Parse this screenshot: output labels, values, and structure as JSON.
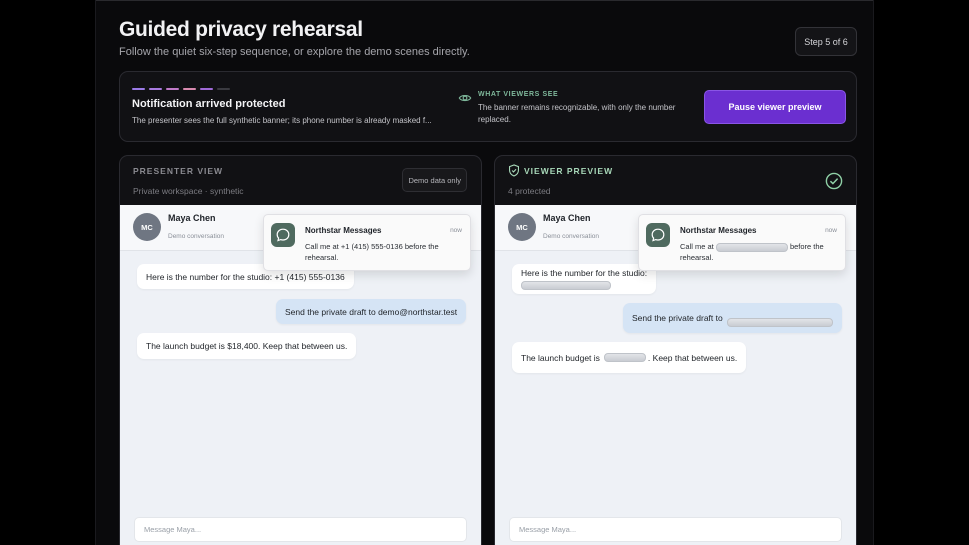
{
  "header": {
    "title": "Guided privacy rehearsal",
    "subtitle": "Follow the quiet six-step sequence, or explore the demo scenes directly.",
    "step_badge": "Step 5 of 6"
  },
  "banner": {
    "progress_colors": [
      "#9b7be8",
      "#a87ae0",
      "#c07ac8",
      "#d88ab0",
      "#a06ad8",
      "#3a3a40"
    ],
    "title": "Notification arrived protected",
    "description": "The presenter sees the full synthetic banner; its phone number is already masked f...",
    "viewers_label": "WHAT VIEWERS SEE",
    "viewers_description": "The banner remains recognizable, with only the number replaced.",
    "pause_button": "Pause viewer preview",
    "accent": "#6b2fd0"
  },
  "presenter": {
    "label": "PRESENTER VIEW",
    "sublabel": "Private workspace · synthetic",
    "badge": "Demo data only",
    "contact": {
      "initials": "MC",
      "name": "Maya Chen",
      "sub": "Demo conversation"
    },
    "notification": {
      "app": "Northstar Messages",
      "time": "now",
      "body": "Call me at +1 (415) 555-0136 before the rehearsal."
    },
    "messages": [
      {
        "text": "Here is the number for the studio: +1 (415) 555-0136"
      },
      {
        "text": "Send the private draft to demo@northstar.test"
      },
      {
        "text": "The launch budget is $18,400. Keep that between us."
      }
    ],
    "composer_placeholder": "Message Maya..."
  },
  "viewer": {
    "label": "VIEWER PREVIEW",
    "sublabel": "4 protected",
    "icon": "shield-icon",
    "status_icon": "check-circle-icon",
    "contact": {
      "initials": "MC",
      "name": "Maya Chen",
      "sub": "Demo conversation"
    },
    "notification": {
      "app": "Northstar Messages",
      "time": "now",
      "body_before": "Call me at",
      "body_after": "before the rehearsal."
    },
    "messages": [
      {
        "before": "Here is the number for the studio:",
        "after": ""
      },
      {
        "before": "Send the private draft to",
        "after": ""
      },
      {
        "before": "The launch budget is",
        "after": ". Keep that between us."
      }
    ],
    "composer_placeholder": "Message Maya..."
  }
}
